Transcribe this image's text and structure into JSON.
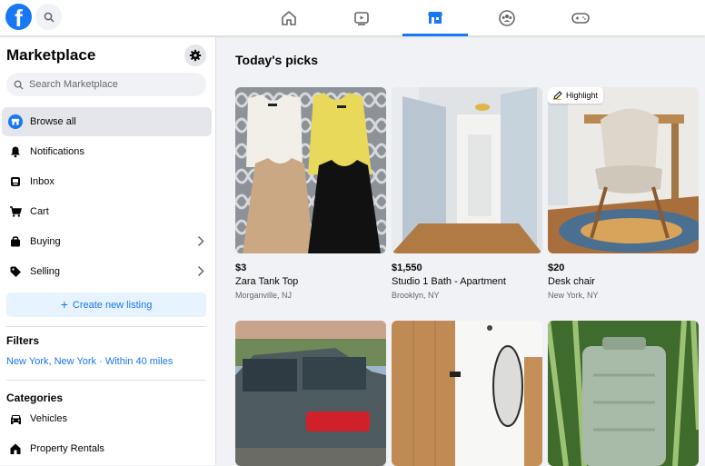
{
  "topbar": {
    "logo_letter": "f",
    "tabs": [
      "home-icon",
      "watch-icon",
      "marketplace-icon",
      "groups-icon",
      "gaming-icon"
    ],
    "accent": "#1877f2"
  },
  "sidebar": {
    "title": "Marketplace",
    "search_placeholder": "Search Marketplace",
    "items": [
      {
        "label": "Browse all",
        "icon": "storefront-icon"
      },
      {
        "label": "Notifications",
        "icon": "bell-icon"
      },
      {
        "label": "Inbox",
        "icon": "messenger-icon"
      },
      {
        "label": "Cart",
        "icon": "cart-icon"
      },
      {
        "label": "Buying",
        "icon": "bag-icon"
      },
      {
        "label": "Selling",
        "icon": "tag-icon"
      }
    ],
    "create_label": "Create new listing",
    "filters_heading": "Filters",
    "filter_location": "New York, New York · Within 40 miles",
    "categories_heading": "Categories",
    "categories": [
      {
        "label": "Vehicles",
        "icon": "car-icon"
      },
      {
        "label": "Property Rentals",
        "icon": "house-icon"
      }
    ]
  },
  "main": {
    "title": "Today's picks",
    "listings": [
      {
        "price": "$3",
        "title": "Zara Tank Top",
        "location": "Morganville, NJ"
      },
      {
        "price": "$1,550",
        "title": "Studio 1 Bath - Apartment",
        "location": "Brooklyn, NY"
      },
      {
        "price": "$20",
        "title": "Desk chair",
        "location": "New York, NY",
        "badge": "Highlight"
      }
    ]
  }
}
